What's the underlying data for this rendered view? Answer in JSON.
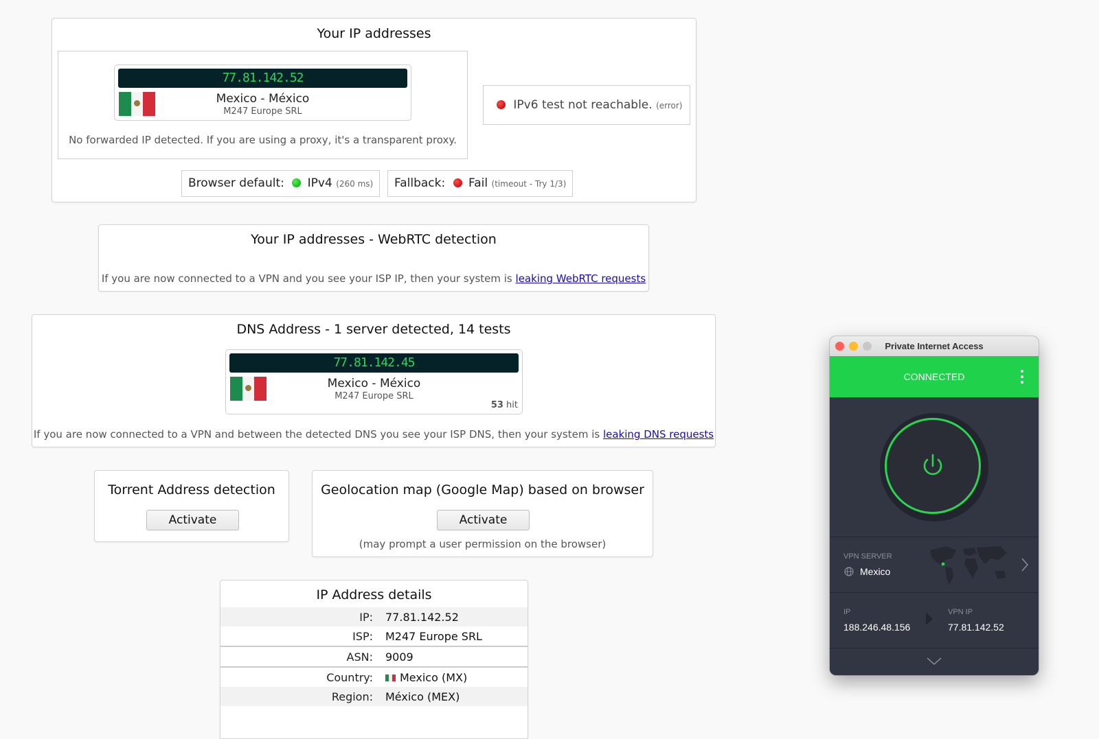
{
  "ip_section": {
    "title": "Your IP addresses",
    "ipv4": {
      "ip": "77.81.142.52",
      "country": "Mexico - México",
      "isp": "M247 Europe SRL"
    },
    "forward_note": "No forwarded IP detected. If you are using a proxy, it's a transparent proxy.",
    "ipv6_status": "IPv6 test not reachable.",
    "ipv6_error": "(error)",
    "browser_default_label": "Browser default:",
    "browser_default_value": "IPv4",
    "browser_default_time": "(260 ms)",
    "fallback_label": "Fallback:",
    "fallback_value": "Fail",
    "fallback_detail": "(timeout - Try 1/3)"
  },
  "webrtc": {
    "title": "Your IP addresses - WebRTC detection",
    "note": "If you are now connected to a VPN and you see your ISP IP, then your system is",
    "link": "leaking WebRTC requests"
  },
  "dns": {
    "title": "DNS Address - 1 server detected, 14 tests",
    "ip": "77.81.142.45",
    "country": "Mexico - México",
    "isp": "M247 Europe SRL",
    "hits": "53",
    "hit_label": "hit",
    "note": "If you are now connected to a VPN and between the detected DNS you see your ISP DNS, then your system is",
    "link": "leaking DNS requests"
  },
  "torrent": {
    "title": "Torrent Address detection",
    "button": "Activate"
  },
  "geo": {
    "title": "Geolocation map (Google Map) based on browser",
    "button": "Activate",
    "note": "(may prompt a user permission on the browser)"
  },
  "details": {
    "title": "IP Address details",
    "rows": [
      {
        "key": "IP:",
        "value": "77.81.142.52"
      },
      {
        "key": "ISP:",
        "value": "M247 Europe SRL"
      },
      {
        "key": "ASN:",
        "value": "9009"
      },
      {
        "key": "Country:",
        "value": "Mexico (MX)"
      },
      {
        "key": "Region:",
        "value": "México (MEX)"
      }
    ]
  },
  "pia": {
    "window_title": "Private Internet Access",
    "status": "CONNECTED",
    "vpn_server_label": "VPN SERVER",
    "vpn_server_value": "Mexico",
    "ip_label": "IP",
    "ip_value": "188.246.48.156",
    "vpn_ip_label": "VPN IP",
    "vpn_ip_value": "77.81.142.52",
    "accent": "#1fd14b"
  }
}
